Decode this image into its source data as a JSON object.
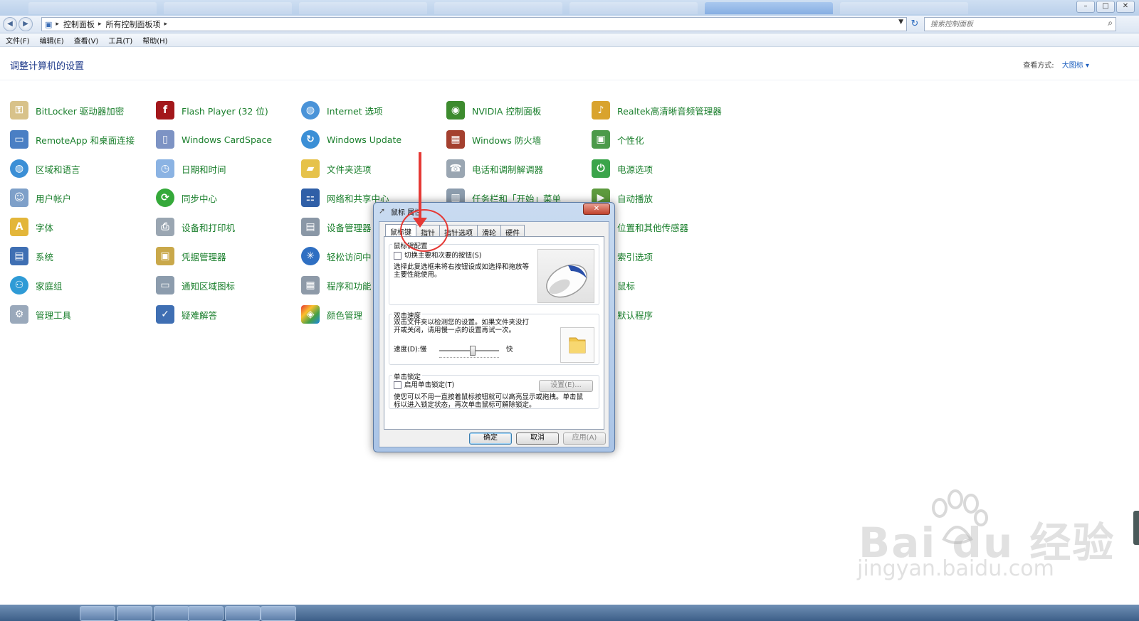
{
  "address": {
    "crumbs": [
      "控制面板",
      "所有控制面板项"
    ],
    "search_placeholder": "搜索控制面板"
  },
  "menubar": [
    "文件(F)",
    "编辑(E)",
    "查看(V)",
    "工具(T)",
    "帮助(H)"
  ],
  "content": {
    "title": "调整计算机的设置",
    "viewby_label": "查看方式:",
    "viewby_value": "大图标 ▾"
  },
  "items": {
    "c0": [
      "BitLocker 驱动器加密",
      "RemoteApp 和桌面连接",
      "区域和语言",
      "用户帐户",
      "字体",
      "系统",
      "家庭组",
      "管理工具"
    ],
    "c1": [
      "Flash Player (32 位)",
      "Windows CardSpace",
      "日期和时间",
      "同步中心",
      "设备和打印机",
      "凭据管理器",
      "通知区域图标",
      "疑难解答"
    ],
    "c2": [
      "Internet 选项",
      "Windows Update",
      "文件夹选项",
      "网络和共享中心",
      "设备管理器",
      "轻松访问中",
      "程序和功能",
      "颜色管理"
    ],
    "c3": [
      "NVIDIA 控制面板",
      "Windows 防火墙",
      "电话和调制解调器",
      "任务栏和「开始」菜单"
    ],
    "c4": [
      "Realtek高清晰音频管理器",
      "个性化",
      "电源选项",
      "自动播放",
      "位置和其他传感器",
      "索引选项",
      "鼠标",
      "默认程序"
    ]
  },
  "dialog": {
    "title": "鼠标 属性",
    "tabs": [
      "鼠标键",
      "指针",
      "指针选项",
      "滑轮",
      "硬件"
    ],
    "button_config": {
      "title": "鼠标键配置",
      "checkbox": "切换主要和次要的按钮(S)",
      "desc": "选择此复选框来将右按钮设成如选择和拖放等主要性能使用。"
    },
    "double_click": {
      "title": "双击速度",
      "desc": "双击文件夹以检测您的设置。如果文件夹没打开或关闭，请用慢一点的设置再试一次。",
      "speed_label": "速度(D):慢",
      "fast_label": "快",
      "speed_value": 0.55
    },
    "click_lock": {
      "title": "单击锁定",
      "checkbox": "启用单击锁定(T)",
      "settings_btn": "设置(E)...",
      "desc": "使您可以不用一直按着鼠标按钮就可以高亮显示或拖拽。单击鼠标以进入锁定状态，再次单击鼠标可解除锁定。"
    },
    "buttons": {
      "ok": "确定",
      "cancel": "取消",
      "apply": "应用(A)"
    }
  },
  "watermark": {
    "brand": "Bai du 经验",
    "url": "jingyan.baidu.com"
  },
  "colors": {
    "link_green": "#1a7f2c",
    "title_blue": "#1e3a8a",
    "annotation_red": "#e53935"
  }
}
